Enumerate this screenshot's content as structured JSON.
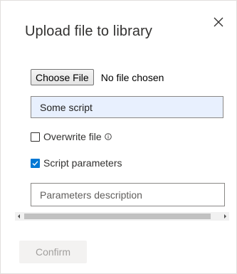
{
  "dialog": {
    "title": "Upload file to library",
    "close_icon": "close-icon"
  },
  "file_input": {
    "button_label": "Choose File",
    "status": "No file chosen"
  },
  "name_field": {
    "value": "Some script"
  },
  "overwrite": {
    "label": "Overwrite file",
    "checked": false,
    "info_icon": "info-icon"
  },
  "script_params": {
    "label": "Script parameters",
    "checked": true
  },
  "params_description": {
    "placeholder": "Parameters description",
    "value": ""
  },
  "footer": {
    "confirm_label": "Confirm",
    "confirm_enabled": false
  },
  "colors": {
    "accent": "#0078d4",
    "autofill_bg": "#e8f0fe",
    "disabled_bg": "#f3f2f1",
    "disabled_text": "#a19f9d"
  }
}
